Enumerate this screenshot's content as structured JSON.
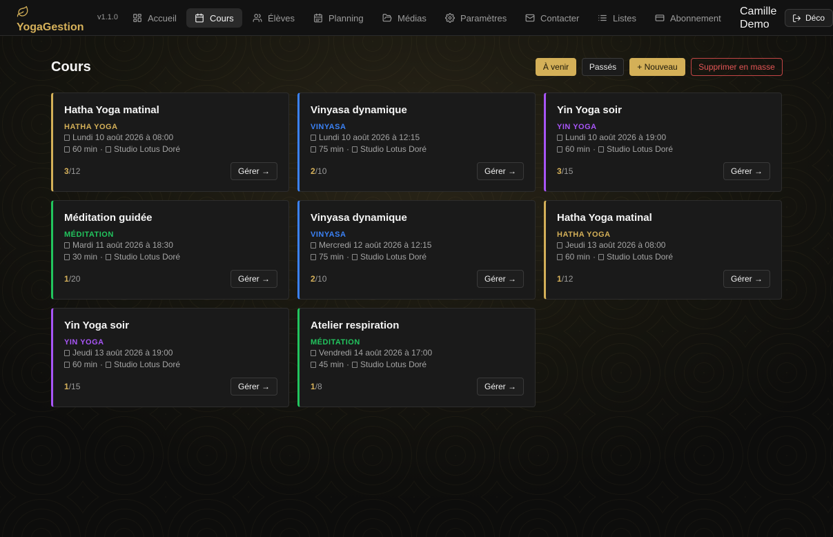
{
  "app": {
    "brand": "YogaGestion",
    "version": "v1.1.0",
    "user_name": "Camille Demo",
    "logout_label": "Déco",
    "accent_color": "#d4b058"
  },
  "nav": [
    {
      "label": "Accueil",
      "icon": "dashboard-icon",
      "active": false
    },
    {
      "label": "Cours",
      "icon": "calendar-icon",
      "active": true
    },
    {
      "label": "Élèves",
      "icon": "users-icon",
      "active": false
    },
    {
      "label": "Planning",
      "icon": "calendar-grid-icon",
      "active": false
    },
    {
      "label": "Médias",
      "icon": "folder-icon",
      "active": false
    },
    {
      "label": "Paramètres",
      "icon": "gear-icon",
      "active": false
    },
    {
      "label": "Contacter",
      "icon": "mail-icon",
      "active": false
    },
    {
      "label": "Listes",
      "icon": "list-icon",
      "active": false
    },
    {
      "label": "Abonnement",
      "icon": "credit-card-icon",
      "active": false
    }
  ],
  "page": {
    "title": "Cours",
    "filters": {
      "upcoming": "À venir",
      "past": "Passés"
    },
    "new_label": "+ Nouveau",
    "bulk_delete_label": "Supprimer en masse"
  },
  "type_colors": {
    "HATHA YOGA": "#d4b058",
    "VINYASA": "#3b82f6",
    "YIN YOGA": "#a855f7",
    "MÉDITATION": "#22c55e"
  },
  "manage_label": "Gérer →",
  "courses": [
    {
      "title": "Hatha Yoga matinal",
      "type": "HATHA YOGA",
      "date": "Lundi 10 août 2026 à 08:00",
      "duration": "60 min",
      "location": "Studio Lotus Doré",
      "booked": "3",
      "capacity": "/12"
    },
    {
      "title": "Vinyasa dynamique",
      "type": "VINYASA",
      "date": "Lundi 10 août 2026 à 12:15",
      "duration": "75 min",
      "location": "Studio Lotus Doré",
      "booked": "2",
      "capacity": "/10"
    },
    {
      "title": "Yin Yoga soir",
      "type": "YIN YOGA",
      "date": "Lundi 10 août 2026 à 19:00",
      "duration": "60 min",
      "location": "Studio Lotus Doré",
      "booked": "3",
      "capacity": "/15"
    },
    {
      "title": "Méditation guidée",
      "type": "MÉDITATION",
      "date": "Mardi 11 août 2026 à 18:30",
      "duration": "30 min",
      "location": "Studio Lotus Doré",
      "booked": "1",
      "capacity": "/20"
    },
    {
      "title": "Vinyasa dynamique",
      "type": "VINYASA",
      "date": "Mercredi 12 août 2026 à 12:15",
      "duration": "75 min",
      "location": "Studio Lotus Doré",
      "booked": "2",
      "capacity": "/10"
    },
    {
      "title": "Hatha Yoga matinal",
      "type": "HATHA YOGA",
      "date": "Jeudi 13 août 2026 à 08:00",
      "duration": "60 min",
      "location": "Studio Lotus Doré",
      "booked": "1",
      "capacity": "/12"
    },
    {
      "title": "Yin Yoga soir",
      "type": "YIN YOGA",
      "date": "Jeudi 13 août 2026 à 19:00",
      "duration": "60 min",
      "location": "Studio Lotus Doré",
      "booked": "1",
      "capacity": "/15"
    },
    {
      "title": "Atelier respiration",
      "type": "MÉDITATION",
      "date": "Vendredi 14 août 2026 à 17:00",
      "duration": "45 min",
      "location": "Studio Lotus Doré",
      "booked": "1",
      "capacity": "/8"
    }
  ]
}
